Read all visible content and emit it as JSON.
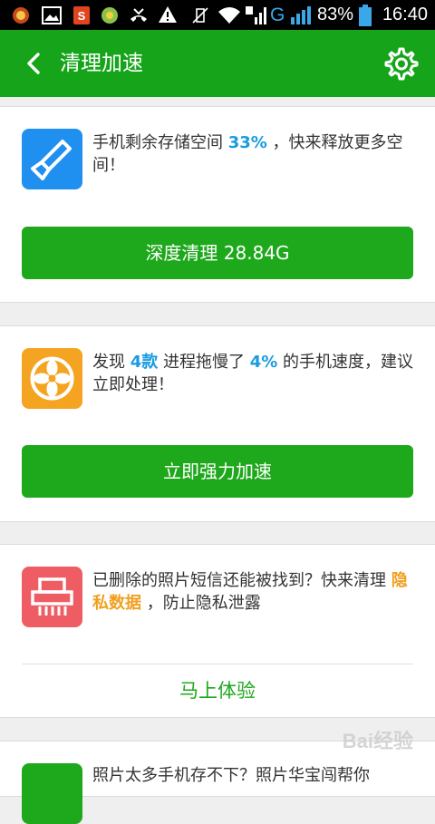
{
  "status_bar": {
    "network": "G",
    "battery": "83%",
    "time": "16:40"
  },
  "header": {
    "title": "清理加速"
  },
  "cards": [
    {
      "text_before": "手机剩余存储空间 ",
      "highlight": "33%",
      "text_after": " ，快来释放更多空间！",
      "button": "深度清理 28.84G"
    },
    {
      "text_1": "发现 ",
      "highlight_1": "4款",
      "text_2": " 进程拖慢了 ",
      "highlight_2": "4%",
      "text_3": " 的手机速度，建议立即处理！",
      "button": "立即强力加速"
    },
    {
      "text_before": "已删除的照片短信还能被找到？快来清理 ",
      "highlight": "隐私数据",
      "text_after": " ，防止隐私泄露",
      "link": "马上体验"
    },
    {
      "text": "照片太多手机存不下？照片华宝闯帮你"
    }
  ],
  "watermark": "Bai经验",
  "colors": {
    "brand_green": "#16a51a",
    "button_green": "#1ea81c",
    "highlight_blue": "#1a9be0",
    "highlight_orange": "#f0a020",
    "icon_blue": "#1f8ff0",
    "icon_orange": "#f5a421",
    "icon_red": "#ee5d64"
  }
}
